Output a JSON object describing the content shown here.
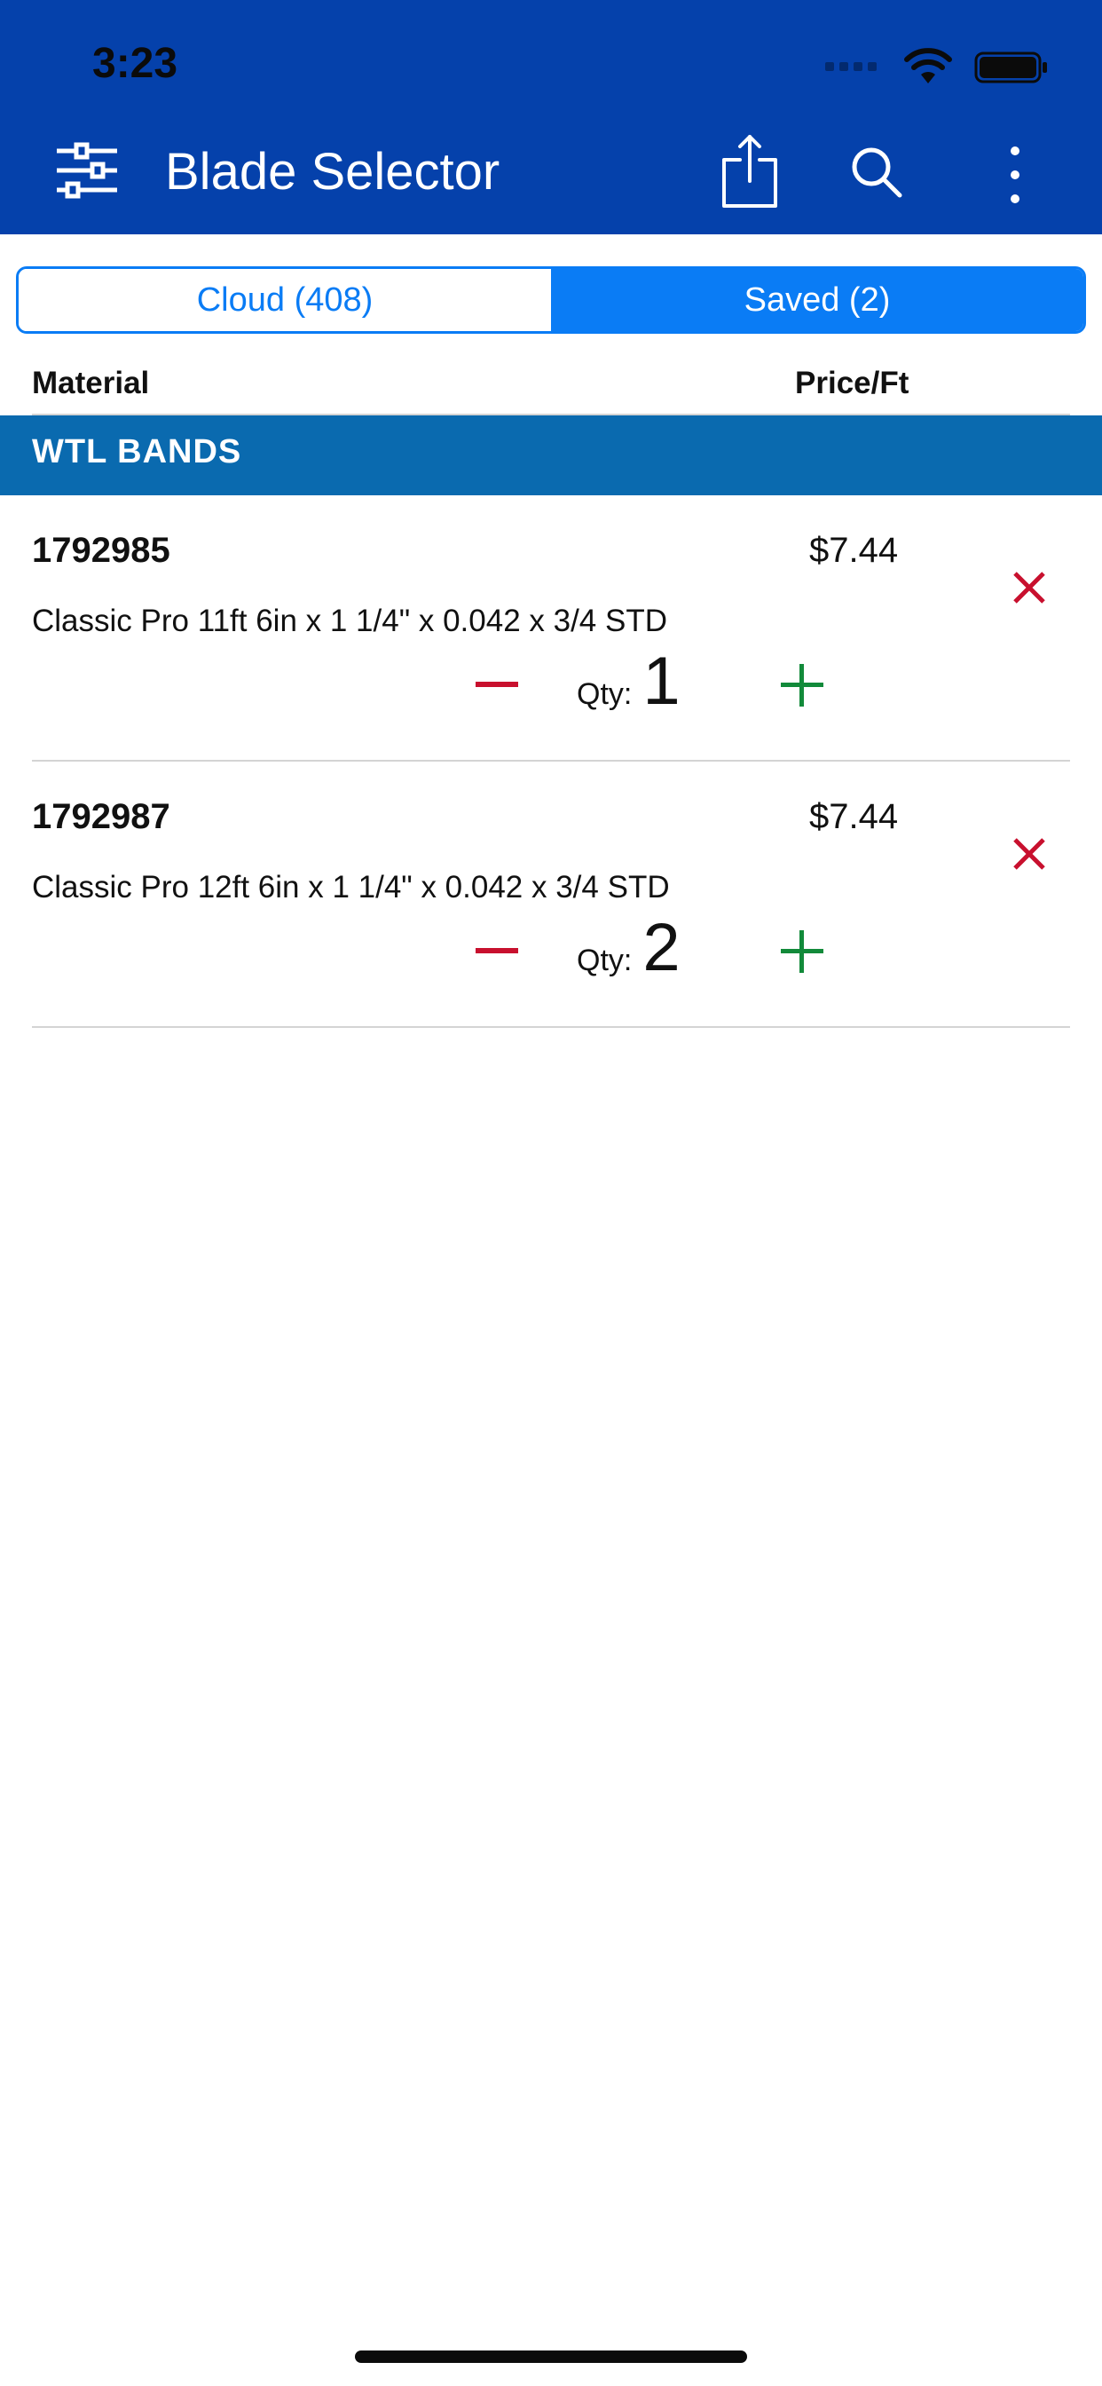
{
  "status_bar": {
    "time": "3:23"
  },
  "header": {
    "title": "Blade Selector"
  },
  "tabs": [
    {
      "label": "Cloud (408)",
      "selected": false
    },
    {
      "label": "Saved (2)",
      "selected": true
    }
  ],
  "columns": {
    "material": "Material",
    "price": "Price/Ft"
  },
  "section": {
    "title": "WTL BANDS"
  },
  "items": [
    {
      "code": "1792985",
      "price": "$7.44",
      "description": "Classic Pro 11ft 6in x 1 1/4\" x 0.042 x 3/4 STD",
      "qty_label": "Qty:",
      "qty": "1"
    },
    {
      "code": "1792987",
      "price": "$7.44",
      "description": "Classic Pro 12ft 6in x 1 1/4\" x 0.042 x 3/4 STD",
      "qty_label": "Qty:",
      "qty": "2"
    }
  ],
  "colors": {
    "header": "#0541ab",
    "accent": "#0a7cf5",
    "section": "#0a6aaf",
    "remove": "#c8102e",
    "increment": "#128a3a"
  },
  "icons": [
    "filter-sliders-icon",
    "share-icon",
    "search-icon",
    "more-vertical-icon",
    "remove-icon",
    "minus-icon",
    "plus-icon"
  ]
}
